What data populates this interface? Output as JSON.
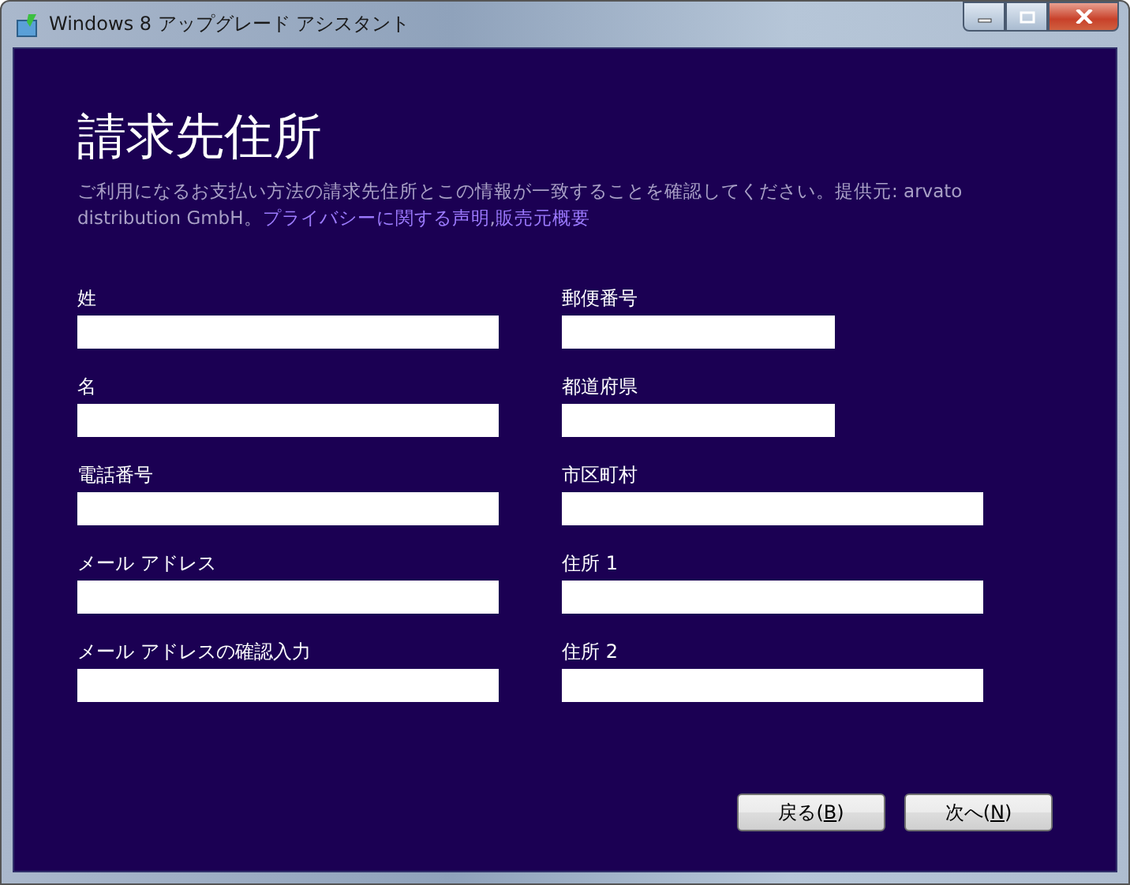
{
  "window": {
    "title": "Windows 8 アップグレード アシスタント"
  },
  "heading": "請求先住所",
  "description": {
    "text": "ご利用になるお支払い方法の請求先住所とこの情報が一致することを確認してください。提供元: arvato distribution GmbH。",
    "links": [
      "プライバシーに関する声明",
      "販売元概要"
    ],
    "separator": ","
  },
  "left_fields": [
    {
      "label": "姓",
      "kind": "long"
    },
    {
      "label": "名",
      "kind": "long"
    },
    {
      "label": "電話番号",
      "kind": "long"
    },
    {
      "label": "メール アドレス",
      "kind": "long"
    },
    {
      "label": "メール アドレスの確認入力",
      "kind": "long"
    }
  ],
  "right_fields": [
    {
      "label": "郵便番号",
      "kind": "short"
    },
    {
      "label": "都道府県",
      "kind": "short"
    },
    {
      "label": "市区町村",
      "kind": "long"
    },
    {
      "label": "住所 1",
      "kind": "long"
    },
    {
      "label": "住所 2",
      "kind": "long"
    }
  ],
  "buttons": [
    {
      "before": "戻る(",
      "accesskey": "B",
      "after": ")"
    },
    {
      "before": "次へ(",
      "accesskey": "N",
      "after": ")"
    }
  ]
}
